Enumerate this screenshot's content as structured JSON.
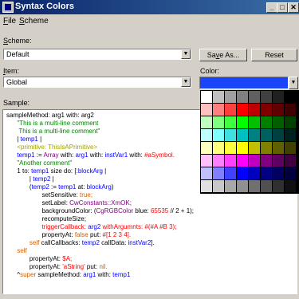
{
  "window": {
    "title": "Syntax Colors"
  },
  "menu": [
    {
      "first": "F",
      "rest": "ile"
    },
    {
      "first": "S",
      "rest": "cheme"
    }
  ],
  "scheme": {
    "label_first": "S",
    "label_rest": "cheme:",
    "value": "Default",
    "save_first": "Sa",
    "save_u": "v",
    "save_rest": "e As...",
    "reset": "Reset"
  },
  "item": {
    "label_first": "I",
    "label_rest": "tem:",
    "value": "Global"
  },
  "color": {
    "label": "Color:",
    "selected": "#1a45f8"
  },
  "sample": {
    "label": "Sample:"
  },
  "code": [
    [
      {
        "t": "sampleMethod: arg1 with: arg2",
        "c": "k"
      }
    ],
    [
      {
        "t": "      \"This is a multi-line comment",
        "c": "green"
      }
    ],
    [
      {
        "t": "       This is a multi-line comment\"",
        "c": "green"
      }
    ],
    [
      {
        "t": "      | ",
        "c": "k"
      },
      {
        "t": "temp1",
        "c": "blue"
      },
      {
        "t": " |",
        "c": "k"
      }
    ],
    [
      {
        "t": "      <primitive: ThisIsAPrimitive>",
        "c": "olive"
      }
    ],
    [
      {
        "t": "      ",
        "c": "k"
      },
      {
        "t": "temp1",
        "c": "blue"
      },
      {
        "t": " := ",
        "c": "k"
      },
      {
        "t": "Array",
        "c": "purple"
      },
      {
        "t": " with: ",
        "c": "k"
      },
      {
        "t": "arg1",
        "c": "blue"
      },
      {
        "t": " with: ",
        "c": "k"
      },
      {
        "t": "instVar1",
        "c": "blue"
      },
      {
        "t": " with: ",
        "c": "k"
      },
      {
        "t": "#aSymbol.",
        "c": "red"
      }
    ],
    [
      {
        "t": "      \"Another comment\"",
        "c": "green"
      }
    ],
    [
      {
        "t": "      1 to: ",
        "c": "k"
      },
      {
        "t": "temp1",
        "c": "blue"
      },
      {
        "t": " size do: [:",
        "c": "k"
      },
      {
        "t": "blockArg",
        "c": "blue"
      },
      {
        "t": " |",
        "c": "k"
      }
    ],
    [
      {
        "t": "             | ",
        "c": "k"
      },
      {
        "t": "temp2",
        "c": "blue"
      },
      {
        "t": " |",
        "c": "k"
      }
    ],
    [
      {
        "t": "             (",
        "c": "k"
      },
      {
        "t": "temp2",
        "c": "blue"
      },
      {
        "t": " := ",
        "c": "k"
      },
      {
        "t": "temp1",
        "c": "blue"
      },
      {
        "t": " at: ",
        "c": "k"
      },
      {
        "t": "blockArg",
        "c": "blue"
      },
      {
        "t": ")",
        "c": "k"
      }
    ],
    [
      {
        "t": "                    setSensitive: ",
        "c": "k"
      },
      {
        "t": "true;",
        "c": "orange"
      }
    ],
    [
      {
        "t": "                    setLabel: ",
        "c": "k"
      },
      {
        "t": "CwConstants::XmOK;",
        "c": "purple"
      }
    ],
    [
      {
        "t": "                    backgroundColor: (",
        "c": "k"
      },
      {
        "t": "CgRGBColor",
        "c": "purple"
      },
      {
        "t": " blue: ",
        "c": "k"
      },
      {
        "t": "65535",
        "c": "red"
      },
      {
        "t": " // 2 + 1);",
        "c": "k"
      }
    ],
    [
      {
        "t": "                    recomputeSize;",
        "c": "k"
      }
    ],
    [
      {
        "t": "                    ",
        "c": "k"
      },
      {
        "t": "triggerCallback: ",
        "c": "red"
      },
      {
        "t": "arg2",
        "c": "blue"
      },
      {
        "t": " withArgumnts: ",
        "c": "red"
      },
      {
        "t": "#(#A #B 3);",
        "c": "red"
      }
    ],
    [
      {
        "t": "                    propertyAt: ",
        "c": "k"
      },
      {
        "t": "false",
        "c": "orange"
      },
      {
        "t": " put: ",
        "c": "k"
      },
      {
        "t": "#[1 2 3 4].",
        "c": "red"
      }
    ],
    [
      {
        "t": "             ",
        "c": "k"
      },
      {
        "t": "self",
        "c": "orange"
      },
      {
        "t": " callCallbacks: ",
        "c": "k"
      },
      {
        "t": "temp2",
        "c": "blue"
      },
      {
        "t": " callData: ",
        "c": "k"
      },
      {
        "t": "instVar2",
        "c": "blue"
      },
      {
        "t": "].",
        "c": "k"
      }
    ],
    [
      {
        "t": "      ",
        "c": "k"
      },
      {
        "t": "self",
        "c": "orange"
      }
    ],
    [
      {
        "t": "             propertyAt: ",
        "c": "k"
      },
      {
        "t": "$A;",
        "c": "red"
      }
    ],
    [
      {
        "t": "             propertyAt: ",
        "c": "k"
      },
      {
        "t": "'aString'",
        "c": "red"
      },
      {
        "t": " put: ",
        "c": "k"
      },
      {
        "t": "nil.",
        "c": "orange"
      }
    ],
    [
      {
        "t": "      ^",
        "c": "k"
      },
      {
        "t": "super",
        "c": "orange"
      },
      {
        "t": " sampleMethod: ",
        "c": "k"
      },
      {
        "t": "arg1",
        "c": "blue"
      },
      {
        "t": " with: ",
        "c": "k"
      },
      {
        "t": "temp1",
        "c": "blue"
      }
    ]
  ],
  "palette": {
    "columns": [
      [
        "#ffffff",
        "#ffc0c0",
        "#c0ffc0",
        "#c0ffff",
        "#ffffc0",
        "#ffc0ff",
        "#c0c0ff",
        "#e0e0e0"
      ],
      [
        "#c0c0c0",
        "#ff8080",
        "#80ff80",
        "#80ffff",
        "#ffff80",
        "#ff80ff",
        "#8080ff",
        "#c8c8c8"
      ],
      [
        "#a0a0a0",
        "#ff4040",
        "#40ff40",
        "#40e0e0",
        "#ffff40",
        "#ff40ff",
        "#4040ff",
        "#a8a8a8"
      ],
      [
        "#808080",
        "#ff0000",
        "#00ff00",
        "#00c0c0",
        "#ffff00",
        "#ff00ff",
        "#0000ff",
        "#909090"
      ],
      [
        "#606060",
        "#c00000",
        "#00c000",
        "#008080",
        "#c0c000",
        "#c000c0",
        "#0000c0",
        "#707070"
      ],
      [
        "#404040",
        "#800000",
        "#008000",
        "#006060",
        "#808000",
        "#800080",
        "#000080",
        "#505050"
      ],
      [
        "#202020",
        "#600000",
        "#006000",
        "#004040",
        "#606000",
        "#600060",
        "#000060",
        "#303030"
      ],
      [
        "#000000",
        "#400000",
        "#004000",
        "#002020",
        "#404000",
        "#400040",
        "#000040",
        "#101010"
      ]
    ]
  }
}
